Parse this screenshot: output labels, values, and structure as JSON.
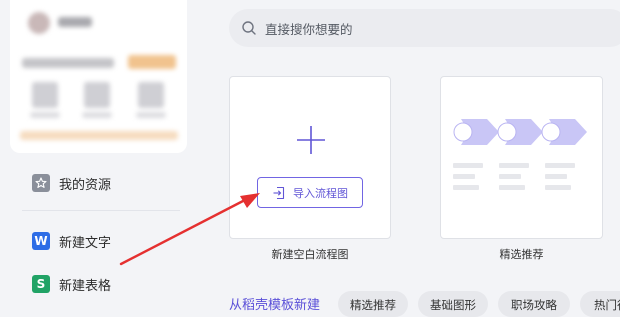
{
  "sidebar": {
    "items": [
      {
        "label": "我的资源",
        "icon": "star-box-icon"
      },
      {
        "label": "新建文字",
        "icon": "wps-writer-icon",
        "badge": "W"
      },
      {
        "label": "新建表格",
        "icon": "wps-sheet-icon",
        "badge": "S"
      }
    ]
  },
  "search": {
    "placeholder": "直接搜你想要的"
  },
  "cards": {
    "blank": {
      "button_label": "导入流程图",
      "caption": "新建空白流程图"
    },
    "featured": {
      "caption": "精选推荐"
    }
  },
  "templates": {
    "section_title": "从稻壳模板新建",
    "chips": [
      "精选推荐",
      "基础图形",
      "职场攻略",
      "热门行"
    ]
  },
  "colors": {
    "accent": "#6156d6",
    "accent_light": "#c9c6f6",
    "writer_blue": "#2e6de6",
    "sheet_green": "#21a366",
    "annotation_red": "#e53030"
  }
}
